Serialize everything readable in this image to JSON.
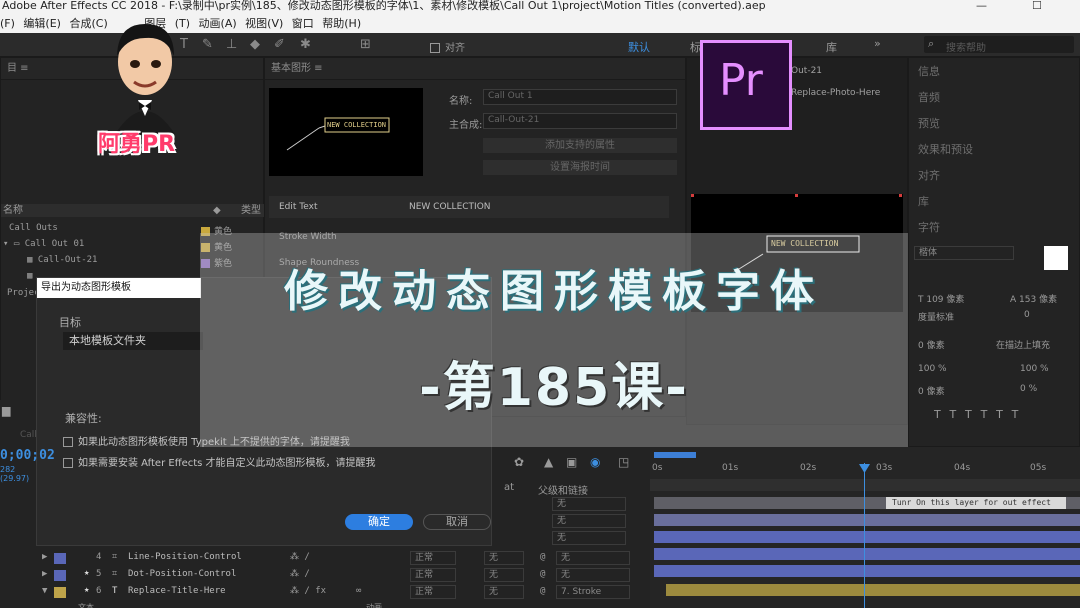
{
  "window": {
    "title": "Adobe After Effects CC 2018 - F:\\录制中\\pr实例\\185、修改动态图形模板的字体\\1、素材\\修改模板\\Call Out 1\\project\\Motion Titles (converted).aep",
    "min": "—",
    "max": "☐",
    "close": "✕"
  },
  "menu": [
    "(F)",
    "编辑(E)",
    "合成(C)",
    "图层",
    "(T)",
    "动画(A)",
    "视图(V)",
    "窗口",
    "帮助(H)"
  ],
  "toolbar": {
    "align_label": "对齐",
    "workspace_default": "默认",
    "workspace_std": "标",
    "library_label": "库",
    "search_placeholder": "搜索帮助"
  },
  "project_panel": {
    "title": "目",
    "col_name": "名称",
    "col_type": "类型",
    "rows": [
      {
        "name": "Call Outs",
        "type": "黄色"
      },
      {
        "name": "Call Out 01",
        "type": "黄色"
      },
      {
        "name": "Call-Out-21",
        "type": "紫色"
      },
      {
        "name": "Project",
        "type": ""
      }
    ]
  },
  "essential_graphics": {
    "title": "基本图形",
    "preview_text": "NEW COLLECTION",
    "name_label": "名称:",
    "name_value": "Call Out 1",
    "master_label": "主合成:",
    "master_value": "Call-Out-21",
    "btn_props": "添加支持的属性",
    "btn_time": "设置海报时间",
    "edit_text_label": "Edit Text",
    "edit_text_value": "NEW COLLECTION",
    "stroke_width_label": "Stroke Width",
    "shape_label": "Shape Roundness"
  },
  "export_dialog": {
    "title": "导出为动态图形模板",
    "target_label": "目标",
    "target_value": "本地模板文件夹",
    "compat_label": "兼容性:",
    "option1": "如果此动态图形模板使用 Typekit 上不提供的字体，请提醒我",
    "option2": "如果需要安装 After Effects 才能自定义此动态图形模板，请提醒我",
    "ok": "确定",
    "cancel": "取消"
  },
  "comp_panel": {
    "tab": "Out-21",
    "layer_name": "Replace-Photo-Here",
    "callout_text": "NEW COLLECTION"
  },
  "right_panel": {
    "items": [
      "信息",
      "音频",
      "预览",
      "效果和预设",
      "对齐",
      "库",
      "字符"
    ],
    "font_value": "楷体",
    "font_size": "109 像素",
    "leading": "153 像素",
    "tracking_mode": "度量标准",
    "tracking_value": "0",
    "stroke_width": "0 像素",
    "stroke_mode": "在描边上填充",
    "vscale": "100 %",
    "hscale": "100 %",
    "baseline": "0 像素",
    "tsume": "0 %"
  },
  "timeline": {
    "timecode": "0;00;02",
    "fps": "282 (29.97)",
    "label_call": "Call",
    "parent_col": "父级和链接",
    "at_col": "at",
    "ruler": [
      "0s",
      "01s",
      "02s",
      "03s",
      "04s",
      "05s"
    ],
    "marker_comment": "Tunr On this layer for out effect",
    "layers": [
      {
        "num": "4",
        "name": "Line-Position-Control",
        "mode": "正常",
        "trk": "无",
        "parent": "无"
      },
      {
        "num": "5",
        "name": "Dot-Position-Control",
        "mode": "正常",
        "trk": "无",
        "parent": "无"
      },
      {
        "num": "6",
        "name": "Replace-Title-Here",
        "mode": "正常",
        "trk": "无",
        "parent": "7. Stroke"
      }
    ],
    "parent_none": "无",
    "bottom_text": "文本",
    "bottom_anim": "动画"
  },
  "overlay": {
    "channel_name": "阿勇PR",
    "pr_logo": "Pr",
    "headline": "修改动态图形模板字体",
    "lesson": "-第185课-"
  },
  "colors": {
    "pr_bg": "#2a0a3a",
    "pr_border": "#e58fff",
    "ae_blue": "#3d7fd6",
    "layer_purple": "#5a67b8",
    "layer_yellow": "#bfa44a"
  }
}
